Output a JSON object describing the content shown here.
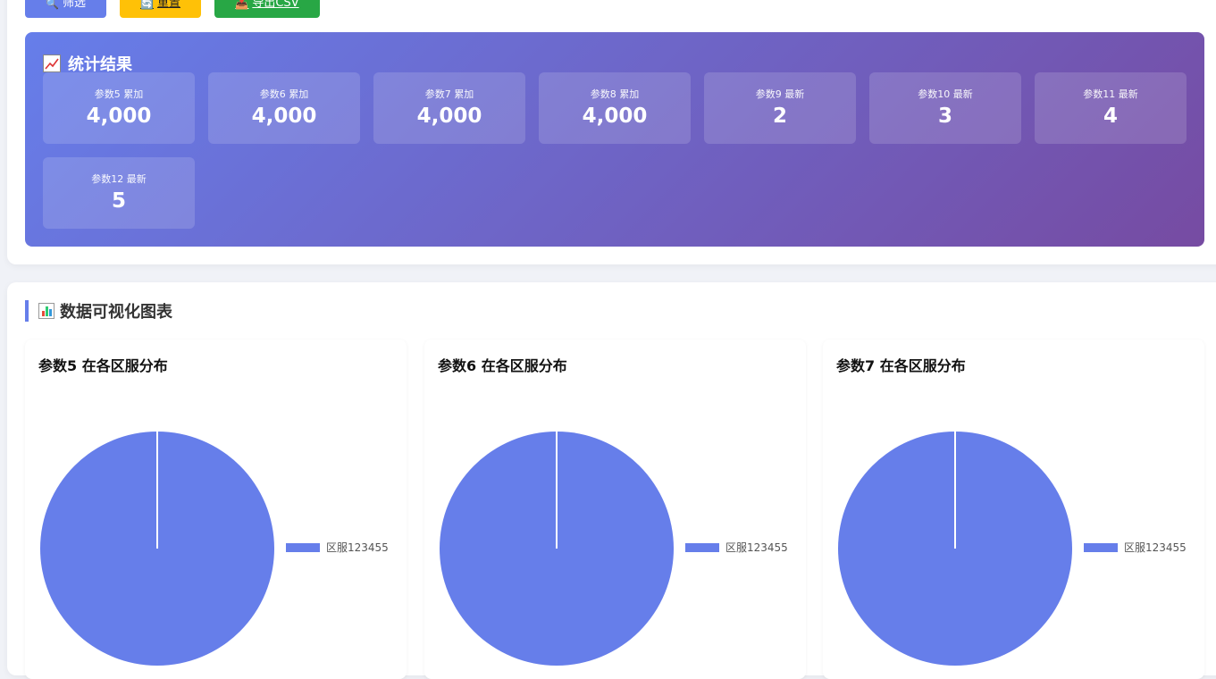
{
  "toolbar": {
    "filter_label": "筛选",
    "reset_label": "重置",
    "export_label": "导出CSV"
  },
  "stats": {
    "title": "统计结果",
    "items": [
      {
        "label": "参数5 累加",
        "value": "4,000"
      },
      {
        "label": "参数6 累加",
        "value": "4,000"
      },
      {
        "label": "参数7 累加",
        "value": "4,000"
      },
      {
        "label": "参数8 累加",
        "value": "4,000"
      },
      {
        "label": "参数9 最新",
        "value": "2"
      },
      {
        "label": "参数10 最新",
        "value": "3"
      },
      {
        "label": "参数11 最新",
        "value": "4"
      },
      {
        "label": "参数12 最新",
        "value": "5"
      }
    ]
  },
  "charts_section": {
    "title": "数据可视化图表"
  },
  "colors": {
    "accent": "#667eea",
    "gradient_end": "#764ba2",
    "reset": "#ffc107",
    "export": "#28a745"
  },
  "chart_data": [
    {
      "type": "pie",
      "title": "参数5 在各区服分布",
      "categories": [
        "区服123455"
      ],
      "values": [
        4000
      ],
      "legend_position": "right"
    },
    {
      "type": "pie",
      "title": "参数6 在各区服分布",
      "categories": [
        "区服123455"
      ],
      "values": [
        4000
      ],
      "legend_position": "right"
    },
    {
      "type": "pie",
      "title": "参数7 在各区服分布",
      "categories": [
        "区服123455"
      ],
      "values": [
        4000
      ],
      "legend_position": "right"
    }
  ]
}
